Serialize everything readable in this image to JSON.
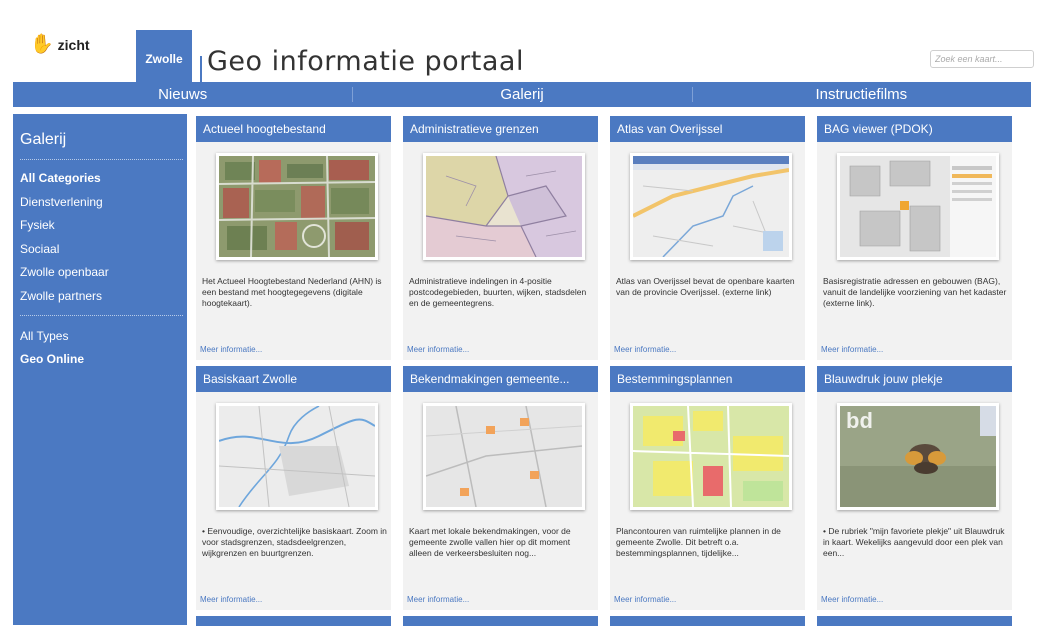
{
  "header": {
    "logo_text": "zicht",
    "logo_icon": "hand-icon",
    "city_label": "Zwolle",
    "title": "Geo informatie portaal",
    "search_placeholder": "Zoek een kaart..."
  },
  "nav": {
    "items": [
      "Nieuws",
      "Galerij",
      "Instructiefilms"
    ]
  },
  "sidebar": {
    "title": "Galerij",
    "categories": [
      "All Categories",
      "Dienstverlening",
      "Fysiek",
      "Sociaal",
      "Zwolle openbaar",
      "Zwolle partners"
    ],
    "types": [
      "All Types",
      "Geo Online"
    ]
  },
  "cards": [
    {
      "title": "Actueel hoogtebestand",
      "desc": "Het Actueel Hoogtebestand Nederland (AHN) is een bestand met hoogtegegevens (digitale hoogtekaart).",
      "more": "Meer informatie..."
    },
    {
      "title": "Administratieve grenzen",
      "desc": "Administratieve indelingen in 4-positie postcodegebieden, buurten, wijken, stadsdelen en de gemeentegrens.",
      "more": "Meer informatie..."
    },
    {
      "title": "Atlas van Overijssel",
      "desc": "Atlas van Overijssel bevat de openbare kaarten van de provincie Overijssel. (externe link)",
      "more": "Meer informatie..."
    },
    {
      "title": "BAG viewer (PDOK)",
      "desc": "Basisregistratie adressen en gebouwen (BAG), vanuit de landelijke voorziening van het kadaster (externe link).",
      "more": "Meer informatie..."
    },
    {
      "title": "Basiskaart Zwolle",
      "desc": "• Eenvoudige, overzichtelijke basiskaart. Zoom in voor stadsgrenzen, stadsdeelgrenzen, wijkgrenzen en buurtgrenzen.",
      "more": "Meer informatie..."
    },
    {
      "title": "Bekendmakingen gemeente...",
      "desc": "Kaart met lokale bekendmakingen, voor de gemeente zwolle vallen hier op dit moment alleen de verkeersbesluiten nog...",
      "more": "Meer informatie..."
    },
    {
      "title": "Bestemmingsplannen",
      "desc": "Plancontouren van ruimtelijke plannen in de gemeente Zwolle. Dit betreft o.a. bestemmingsplannen, tijdelijke...",
      "more": "Meer informatie..."
    },
    {
      "title": "Blauwdruk jouw plekje",
      "desc": "• De rubriek \"mijn favoriete plekje\" uit Blauwdruk in kaart. Wekelijks aangevuld door een plek van een...",
      "more": "Meer informatie..."
    }
  ],
  "thumb_labels": {
    "bd": "bd"
  },
  "colors": {
    "accent": "#4b79c2",
    "card_bg": "#f2f2f2"
  }
}
